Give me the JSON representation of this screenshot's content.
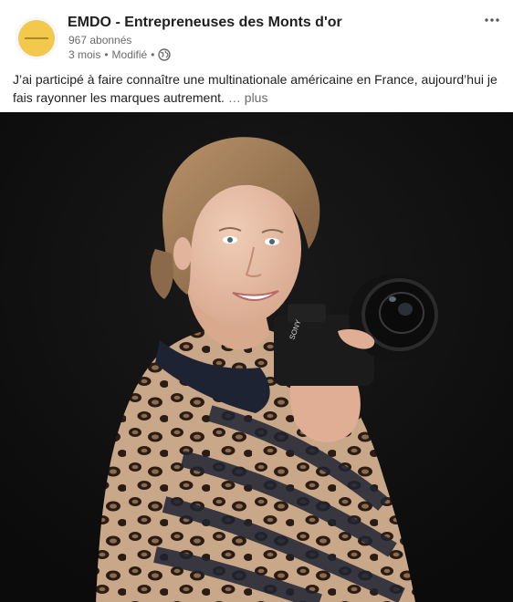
{
  "post": {
    "org_name": "EMDO - Entrepreneuses des Monts d'or",
    "followers": "967 abonnés",
    "age": "3 mois",
    "separator": "•",
    "edited": "Modifié",
    "visibility_icon": "globe-icon",
    "menu_icon": "more-horizontal-icon",
    "text": "J’ai participé à faire connaître une multinationale américaine en France, aujourd’hui je fais rayonner les marques autrement.",
    "see_more": "… plus",
    "logo_icon": "emdo-logo",
    "image": {
      "subject": "woman holding camera",
      "camera_brand": "SONY"
    }
  },
  "colors": {
    "logo_bg": "#f2c94c",
    "text": "#1f1f1f",
    "muted": "#6b6b6b",
    "photo_bg": "#111111"
  }
}
